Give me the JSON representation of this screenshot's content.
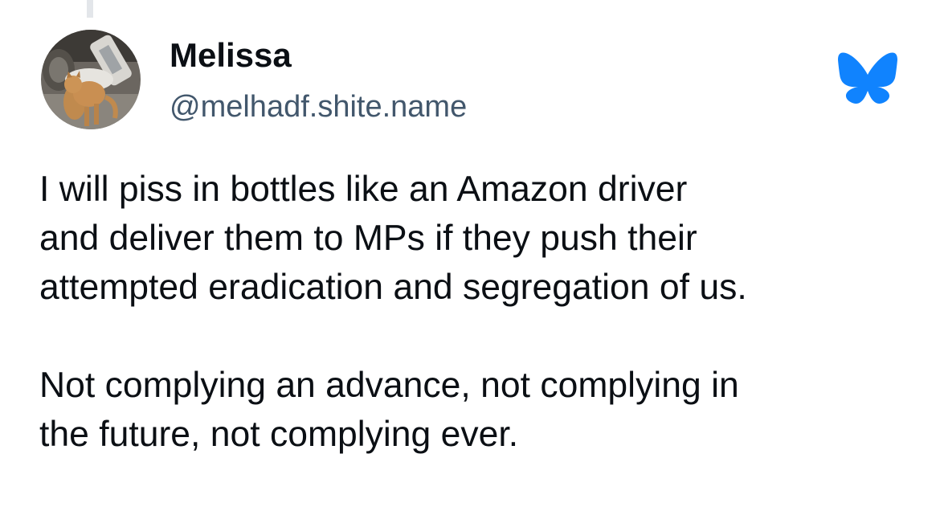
{
  "author": {
    "display_name": "Melissa",
    "handle": "@melhadf.shite.name",
    "avatar_icon": "avatar-cat-photo"
  },
  "app_icon": "bluesky-butterfly-icon",
  "colors": {
    "brand": "#1083fe",
    "text": "#0b0f14",
    "handle": "#42576c"
  },
  "post": {
    "paragraph1_lines": [
      "I will piss in bottles like an Amazon driver",
      "and deliver them to MPs if they push their",
      "attempted eradication and segregation of us."
    ],
    "paragraph2_lines": [
      "Not complying an advance, not complying in",
      "the future, not complying ever."
    ]
  }
}
